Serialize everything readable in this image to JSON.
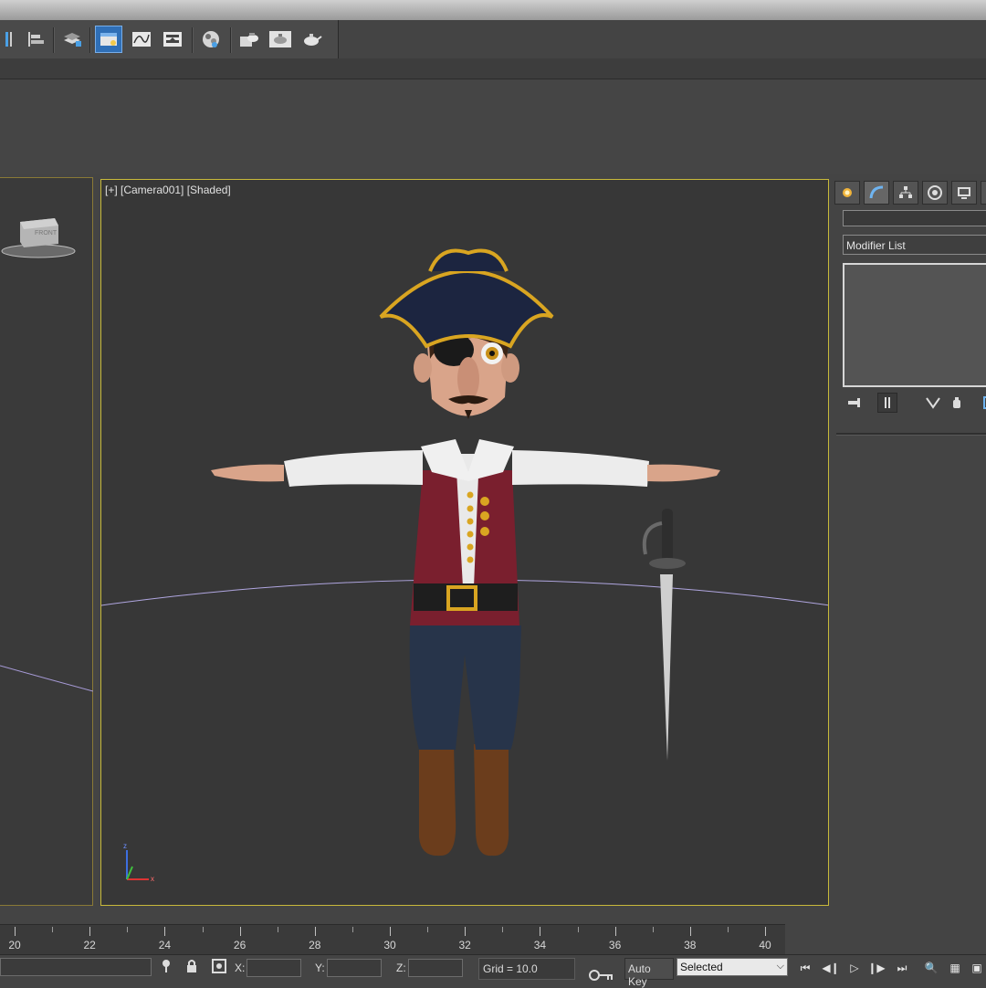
{
  "viewport": {
    "label": "[+] [Camera001] [Shaded]",
    "left_label": "FRONT"
  },
  "toolbar": {
    "buttons": [
      {
        "icon": "mirror-icon"
      },
      {
        "icon": "align-icon"
      },
      {
        "icon": "layer-manager-icon"
      },
      {
        "icon": "scene-explorer-icon",
        "active": true
      },
      {
        "icon": "curve-editor-icon"
      },
      {
        "icon": "schematic-view-icon"
      },
      {
        "icon": "material-editor-icon"
      },
      {
        "icon": "render-setup-icon"
      },
      {
        "icon": "rendered-frame-window-icon"
      },
      {
        "icon": "render-production-icon"
      }
    ]
  },
  "command_panel": {
    "tabs": [
      "create-tab",
      "modify-tab",
      "hierarchy-tab",
      "motion-tab",
      "display-tab",
      "utilities-tab"
    ],
    "active_tab": "modify-tab",
    "object_name": "",
    "modifier_list": "Modifier List"
  },
  "timeline": {
    "ticks": [
      20,
      22,
      24,
      26,
      28,
      30,
      32,
      34,
      36,
      38,
      40
    ]
  },
  "status": {
    "x_label": "X:",
    "y_label": "Y:",
    "z_label": "Z:",
    "x_value": "",
    "y_value": "",
    "z_value": "",
    "grid": "Grid = 10.0",
    "auto_key": "Auto Key",
    "key_mode": "Selected"
  },
  "colors": {
    "viewport_border_active": "#c8b93a",
    "toolbar_active": "#2f6fb7",
    "background": "#444444"
  }
}
